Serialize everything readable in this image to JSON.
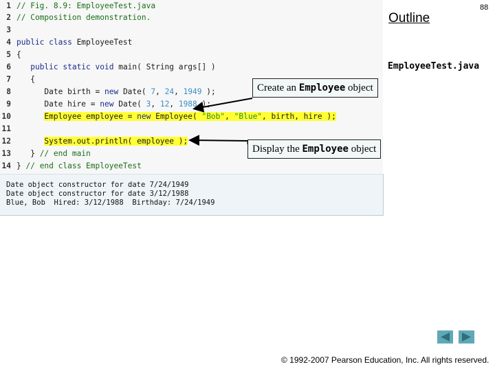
{
  "slide": {
    "page_number": "88",
    "outline_label": "Outline",
    "file_label": "EmployeeTest.java",
    "copyright": "© 1992-2007 Pearson Education, Inc.  All rights reserved."
  },
  "code": {
    "lines": [
      {
        "n": "1",
        "text": "// Fig. 8.9: EmployeeTest.java"
      },
      {
        "n": "2",
        "text": "// Composition demonstration."
      },
      {
        "n": "3",
        "text": ""
      },
      {
        "n": "4",
        "text": "public class EmployeeTest"
      },
      {
        "n": "5",
        "text": "{"
      },
      {
        "n": "6",
        "text": "   public static void main( String args[] )"
      },
      {
        "n": "7",
        "text": "   {"
      },
      {
        "n": "8",
        "text": "      Date birth = new Date( 7, 24, 1949 );"
      },
      {
        "n": "9",
        "text": "      Date hire = new Date( 3, 12, 1988 );"
      },
      {
        "n": "10",
        "text": "      Employee employee = new Employee( \"Bob\", \"Blue\", birth, hire );"
      },
      {
        "n": "11",
        "text": ""
      },
      {
        "n": "12",
        "text": "      System.out.println( employee );"
      },
      {
        "n": "13",
        "text": "   } // end main"
      },
      {
        "n": "14",
        "text": "} // end class EmployeeTest"
      }
    ]
  },
  "output": {
    "lines": [
      "Date object constructor for date 7/24/1949",
      "Date object constructor for date 3/12/1988",
      "Blue, Bob  Hired: 3/12/1988  Birthday: 7/24/1949"
    ]
  },
  "callouts": {
    "create": {
      "prefix": "Create an ",
      "code": "Employee",
      "suffix": " object"
    },
    "display": {
      "prefix": "Display the ",
      "code": "Employee",
      "suffix": " object"
    }
  },
  "nav": {
    "prev_icon": "triangle-left",
    "next_icon": "triangle-right",
    "color": "#5fa8b8",
    "icon_color": "#2e6f78"
  }
}
